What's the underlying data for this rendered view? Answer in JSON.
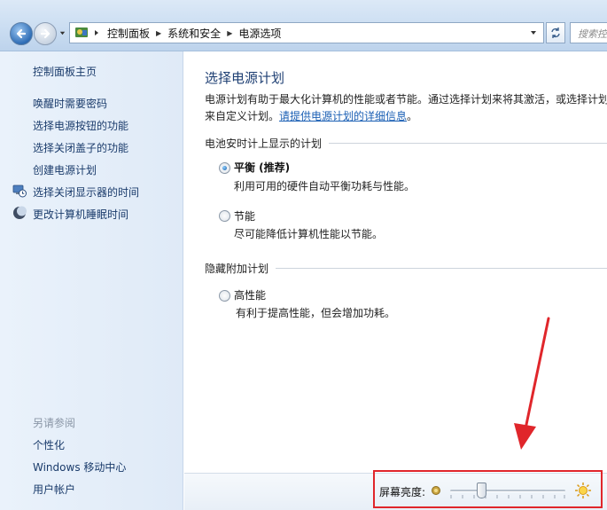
{
  "address": {
    "crumbs": [
      "控制面板",
      "系统和安全",
      "电源选项"
    ],
    "search_placeholder": "搜索控制面板"
  },
  "sidebar": {
    "home": "控制面板主页",
    "items": [
      {
        "label": "唤醒时需要密码",
        "icon": ""
      },
      {
        "label": "选择电源按钮的功能",
        "icon": ""
      },
      {
        "label": "选择关闭盖子的功能",
        "icon": ""
      },
      {
        "label": "创建电源计划",
        "icon": ""
      },
      {
        "label": "选择关闭显示器的时间",
        "icon": "monitor-clock-icon"
      },
      {
        "label": "更改计算机睡眠时间",
        "icon": "moon-icon"
      }
    ],
    "see_also_heading": "另请参阅",
    "see_also": [
      "个性化",
      "Windows 移动中心",
      "用户帐户"
    ]
  },
  "main": {
    "title": "选择电源计划",
    "description": "电源计划有助于最大化计算机的性能或者节能。通过选择计划来将其激活，或选择计划来自定义计划。",
    "description_link": "请提供电源计划的详细信息",
    "description_end": "。",
    "group_battery": "电池安时计上显示的计划",
    "group_hidden": "隐藏附加计划",
    "plans": [
      {
        "name": "平衡 (推荐)",
        "description": "利用可用的硬件自动平衡功耗与性能。",
        "selected": true
      },
      {
        "name": "节能",
        "description": "尽可能降低计算机性能以节能。",
        "selected": false
      },
      {
        "name": "高性能",
        "description": "有利于提高性能，但会增加功耗。",
        "selected": false
      }
    ]
  },
  "brightness": {
    "label": "屏幕亮度:",
    "level_percent": 27
  },
  "colors": {
    "highlight": "#e0262b",
    "link": "#1a5fb4",
    "title": "#1e3f73"
  }
}
